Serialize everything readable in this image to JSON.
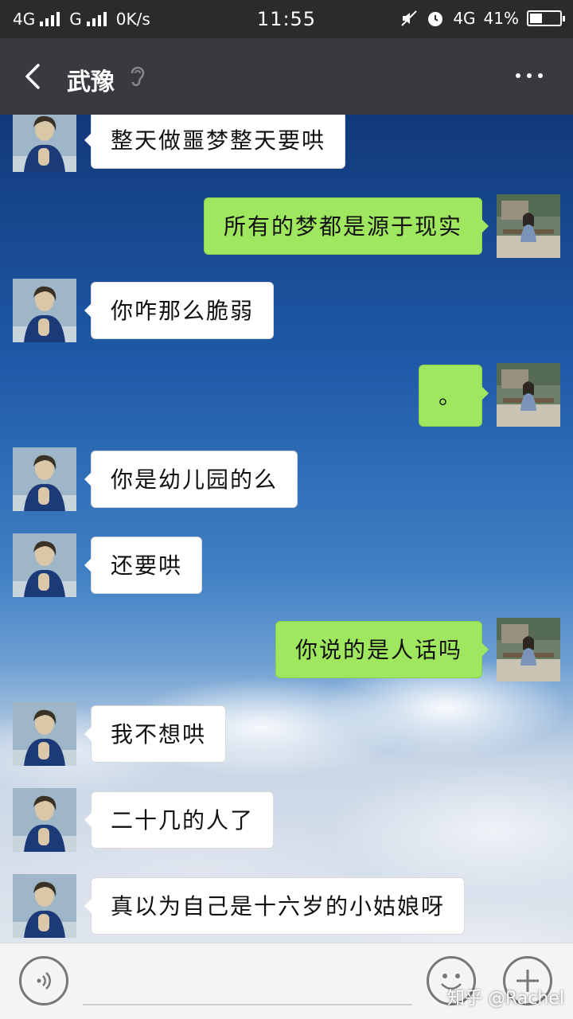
{
  "status_bar": {
    "left_network_1": "4G",
    "left_network_2": "G",
    "speed": "0K/s",
    "time": "11:55",
    "right_network": "4G",
    "battery_percent": "41%",
    "battery_level": 0.41
  },
  "header": {
    "title": "武豫"
  },
  "messages": [
    {
      "side": "in",
      "text": "整天做噩梦整天要哄"
    },
    {
      "side": "out",
      "text": "所有的梦都是源于现实"
    },
    {
      "side": "in",
      "text": "你咋那么脆弱"
    },
    {
      "side": "out",
      "text": "。"
    },
    {
      "side": "in",
      "text": "你是幼儿园的么"
    },
    {
      "side": "in",
      "text": "还要哄"
    },
    {
      "side": "out",
      "text": "你说的是人话吗"
    },
    {
      "side": "in",
      "text": "我不想哄"
    },
    {
      "side": "in",
      "text": "二十几的人了"
    },
    {
      "side": "in",
      "text": "真以为自己是十六岁的小姑娘呀"
    }
  ],
  "watermark": "知乎 @Rachel",
  "colors": {
    "outgoing_bubble": "#9fe75e",
    "incoming_bubble": "#ffffff",
    "header_bg": "#393a3f"
  }
}
